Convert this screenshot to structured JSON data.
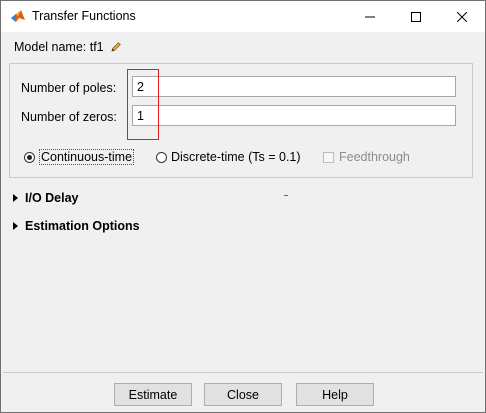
{
  "window": {
    "title": "Transfer Functions",
    "app_icon": "matlab-logo-icon",
    "controls": [
      "minimize-icon",
      "maximize-icon",
      "close-icon"
    ]
  },
  "model": {
    "label": "Model name: tf1",
    "edit_icon": "pencil-icon"
  },
  "fields": {
    "poles_label": "Number of poles:",
    "poles_value": "2",
    "zeros_label": "Number of zeros:",
    "zeros_value": "1"
  },
  "time_domain": {
    "continuous_label": "Continuous-time",
    "discrete_label": "Discrete-time (Ts = 0.1)",
    "feedthrough_label": "Feedthrough",
    "selected": "continuous",
    "feedthrough_checked": false,
    "feedthrough_enabled": false
  },
  "sections": {
    "io_delay": "I/O Delay",
    "estimation_options": "Estimation Options"
  },
  "buttons": {
    "estimate": "Estimate",
    "close": "Close",
    "help": "Help"
  },
  "colors": {
    "highlight": "#e11d1d",
    "window_bg": "#f0f0f0",
    "button_bg": "#e1e1e1"
  }
}
